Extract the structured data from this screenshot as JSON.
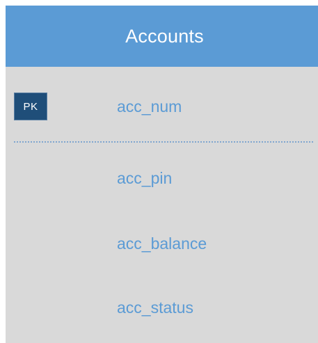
{
  "entity": {
    "title": "Accounts",
    "primary_key_badge": "PK",
    "primary_key_field": "acc_num",
    "fields": [
      "acc_pin",
      "acc_balance",
      "acc_status"
    ]
  },
  "colors": {
    "header": "#5b9bd5",
    "body": "#d9d9d9",
    "pk_badge": "#1f4e79",
    "field_text": "#5b9bd5"
  }
}
